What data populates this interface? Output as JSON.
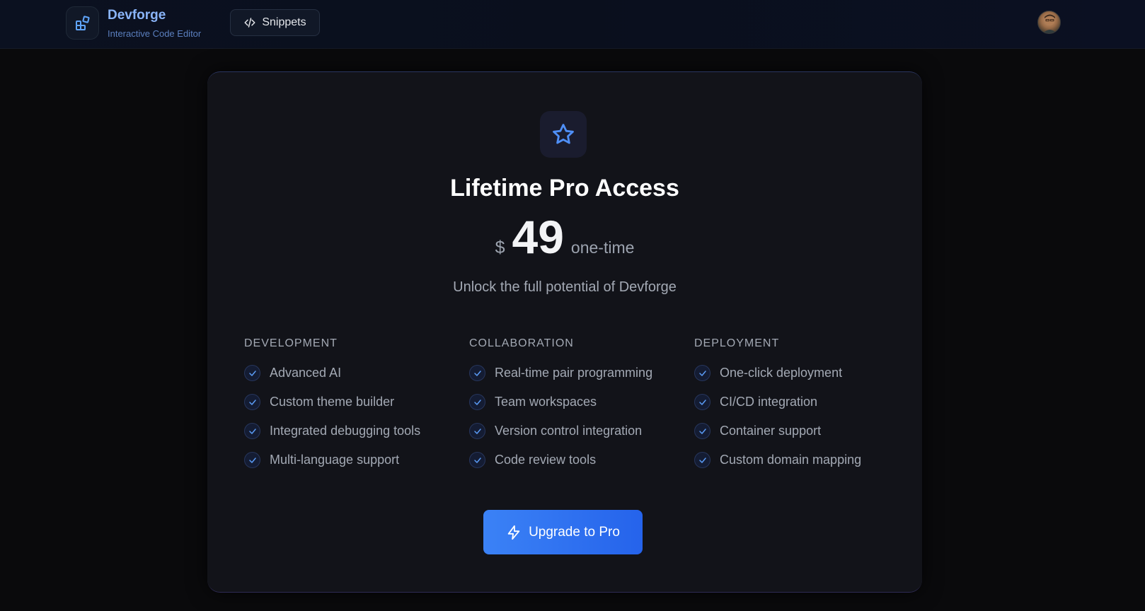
{
  "header": {
    "brand_name": "Devforge",
    "brand_subtitle": "Interactive Code Editor",
    "snippets_label": "Snippets",
    "logo_icon": "layout-grid-icon",
    "accent_color": "#8ab4f8"
  },
  "card": {
    "icon": "star-icon",
    "title": "Lifetime Pro Access",
    "price_currency": "$",
    "price_amount": "49",
    "price_period": "one-time",
    "tagline": "Unlock the full potential of Devforge",
    "columns": [
      {
        "heading": "DEVELOPMENT",
        "features": [
          "Advanced AI",
          "Custom theme builder",
          "Integrated debugging tools",
          "Multi-language support"
        ]
      },
      {
        "heading": "COLLABORATION",
        "features": [
          "Real-time pair programming",
          "Team workspaces",
          "Version control integration",
          "Code review tools"
        ]
      },
      {
        "heading": "DEPLOYMENT",
        "features": [
          "One-click deployment",
          "CI/CD integration",
          "Container support",
          "Custom domain mapping"
        ]
      }
    ],
    "cta_label": "Upgrade to Pro",
    "cta_icon": "zap-icon",
    "cta_color": "#3b82f6"
  }
}
